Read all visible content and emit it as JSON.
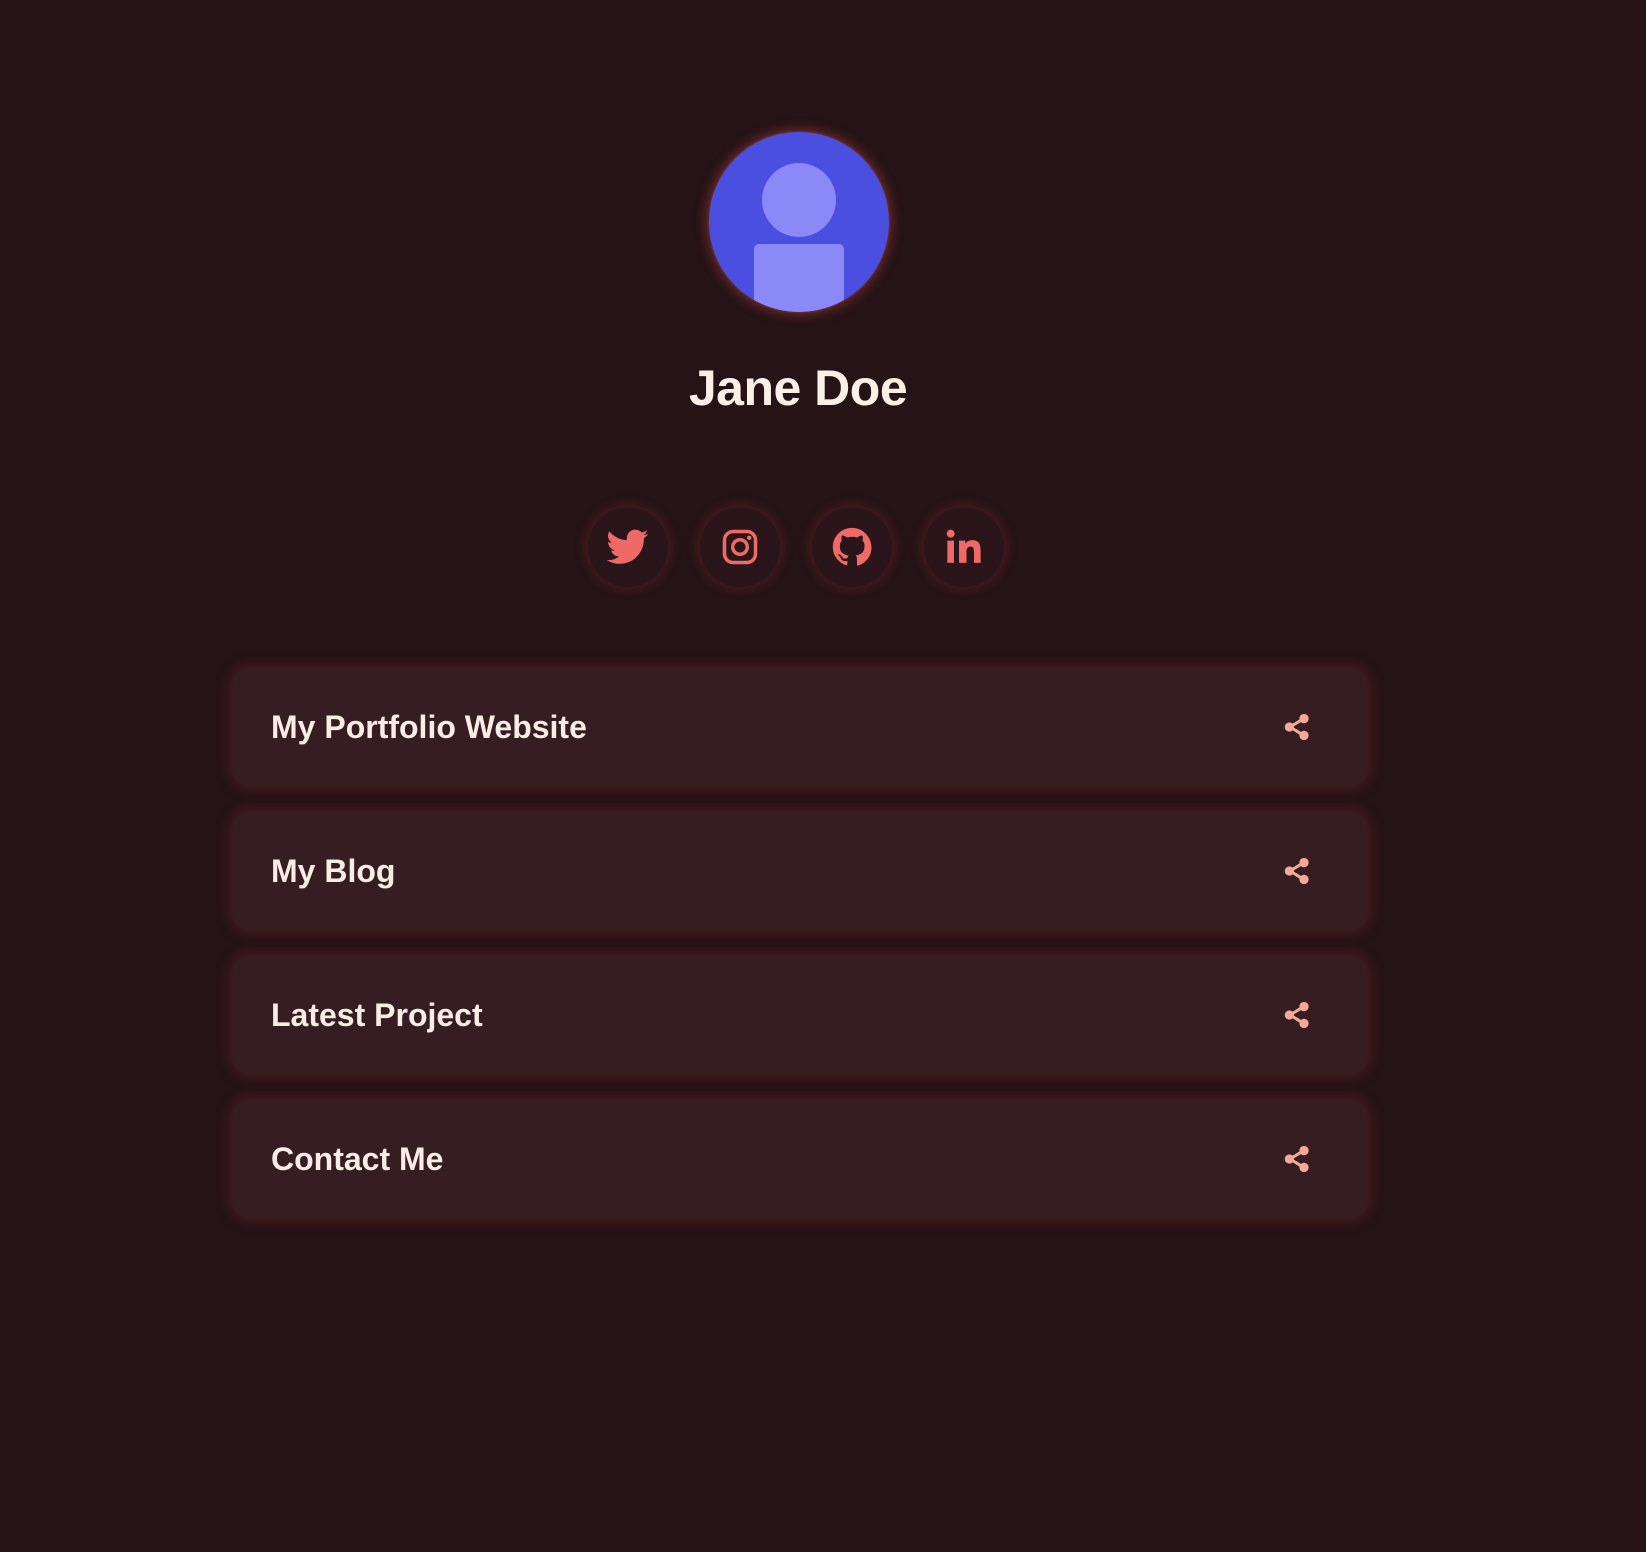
{
  "profile": {
    "name": "Jane Doe",
    "avatar_icon": "user-avatar-icon"
  },
  "social": [
    {
      "name": "twitter",
      "icon": "twitter-icon"
    },
    {
      "name": "instagram",
      "icon": "instagram-icon"
    },
    {
      "name": "github",
      "icon": "github-icon"
    },
    {
      "name": "linkedin",
      "icon": "linkedin-icon"
    }
  ],
  "links": [
    {
      "label": "My Portfolio Website",
      "icon": "share-icon"
    },
    {
      "label": "My Blog",
      "icon": "share-icon"
    },
    {
      "label": "Latest Project",
      "icon": "share-icon"
    },
    {
      "label": "Contact Me",
      "icon": "share-icon"
    }
  ],
  "colors": {
    "background": "#251316",
    "card": "#351d21",
    "accent": "#ee6a66",
    "share_icon": "#f4a99a",
    "avatar_bg": "#4b4fe0",
    "avatar_figure": "#8b89f8",
    "text": "#fbede6"
  }
}
